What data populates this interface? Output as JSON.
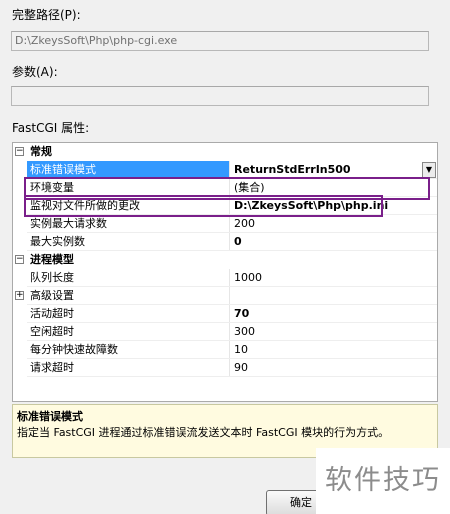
{
  "path_section": {
    "label": "完整路径(P):",
    "value": "D:\\ZkeysSoft\\Php\\php-cgi.exe"
  },
  "args_section": {
    "label": "参数(A):",
    "value": ""
  },
  "properties_label": "FastCGI 属性:",
  "grid": {
    "categories": [
      {
        "name": "常规",
        "expanded": true,
        "rows": [
          {
            "name": "标准错误模式",
            "value": "ReturnStdErrIn500",
            "bold": true,
            "selected": true
          },
          {
            "name": "环境变量",
            "value": "(集合)",
            "bold": false,
            "selected": false
          },
          {
            "name": "监视对文件所做的更改",
            "value": "D:\\ZkeysSoft\\Php\\php.ini",
            "bold": true,
            "selected": false
          },
          {
            "name": "实例最大请求数",
            "value": "200",
            "bold": false,
            "selected": false
          },
          {
            "name": "最大实例数",
            "value": "0",
            "bold": true,
            "selected": false
          }
        ]
      },
      {
        "name": "进程模型",
        "expanded": true,
        "rows": [
          {
            "name": "队列长度",
            "value": "1000",
            "bold": false
          },
          {
            "name": "高级设置",
            "value": "",
            "bold": false,
            "expandable": true
          },
          {
            "name": "活动超时",
            "value": "70",
            "bold": true
          },
          {
            "name": "空闲超时",
            "value": "300",
            "bold": false
          },
          {
            "name": "每分钟快速故障数",
            "value": "10",
            "bold": false
          },
          {
            "name": "请求超时",
            "value": "90",
            "bold": false
          }
        ]
      }
    ],
    "expander_collapse_glyph": "−",
    "expander_expand_glyph": "+",
    "dropdown_glyph": "▼"
  },
  "description": {
    "title": "标准错误模式",
    "text": "指定当 FastCGI 进程通过标准错误流发送文本时 FastCGI 模块的行为方式。"
  },
  "ok_button": {
    "label": "确定"
  },
  "watermark": "软件技巧",
  "colors": {
    "selection": "#3399ff",
    "highlight_border": "#7a1f8a",
    "description_bg": "#fffbe0"
  }
}
